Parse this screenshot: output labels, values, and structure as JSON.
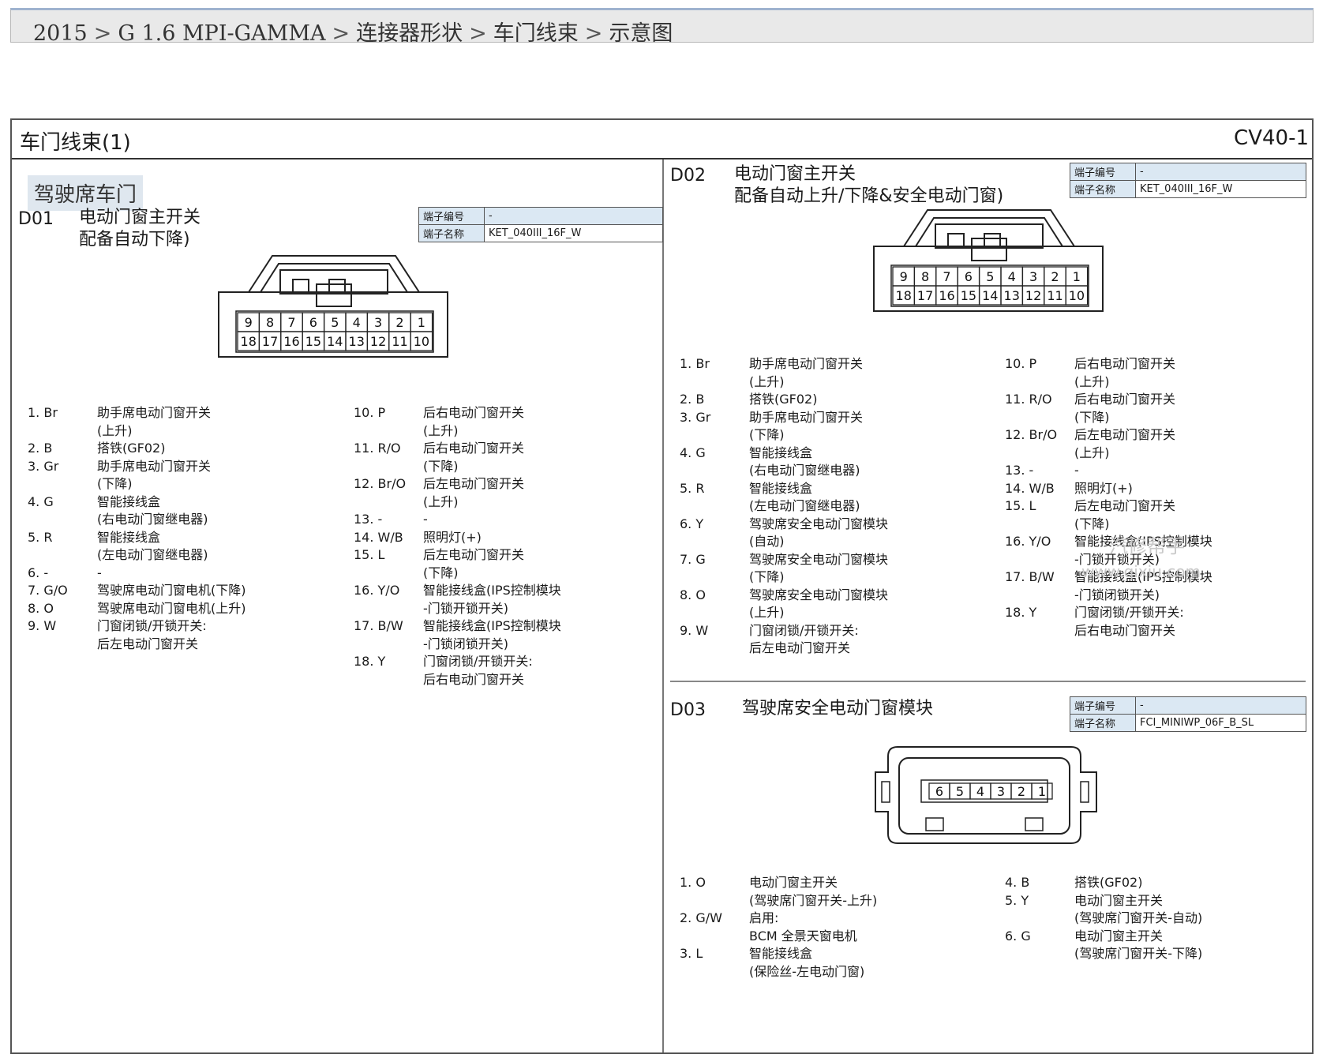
{
  "breadcrumb": {
    "items": [
      "2015",
      "G 1.6 MPI-GAMMA",
      "连接器形状",
      "车门线束",
      "示意图"
    ],
    "separator": ">"
  },
  "sheet": {
    "title": "车门线束(1)",
    "code": "CV40-1",
    "section_label": "驾驶席车门"
  },
  "connectors": {
    "d01": {
      "id": "D01",
      "title_lines": [
        "电动门窗主开关",
        "配备自动下降)"
      ],
      "terminal_no_label": "端子编号",
      "terminal_no_value": "-",
      "terminal_name_label": "端子名称",
      "terminal_name_value": "KET_040III_16F_W",
      "top_pins": [
        "9",
        "8",
        "7",
        "6",
        "5",
        "4",
        "3",
        "2",
        "1"
      ],
      "bottom_pins": [
        "18",
        "17",
        "16",
        "15",
        "14",
        "13",
        "12",
        "11",
        "10"
      ],
      "pins_left": [
        {
          "num": "1. Br",
          "lines": [
            "助手席电动门窗开关",
            "(上升)"
          ]
        },
        {
          "num": "2. B",
          "lines": [
            "搭铁(GF02)"
          ]
        },
        {
          "num": "3. Gr",
          "lines": [
            "助手席电动门窗开关",
            "(下降)"
          ]
        },
        {
          "num": "4. G",
          "lines": [
            "智能接线盒",
            "(右电动门窗继电器)"
          ]
        },
        {
          "num": "5. R",
          "lines": [
            "智能接线盒",
            "(左电动门窗继电器)"
          ]
        },
        {
          "num": "6. -",
          "lines": [
            "-"
          ]
        },
        {
          "num": "7. G/O",
          "lines": [
            "驾驶席电动门窗电机(下降)"
          ]
        },
        {
          "num": "8. O",
          "lines": [
            "驾驶席电动门窗电机(上升)"
          ]
        },
        {
          "num": "9. W",
          "lines": [
            "门窗闭锁/开锁开关:",
            "后左电动门窗开关"
          ]
        }
      ],
      "pins_right": [
        {
          "num": "10. P",
          "lines": [
            "后右电动门窗开关",
            "(上升)"
          ]
        },
        {
          "num": "11. R/O",
          "lines": [
            "后右电动门窗开关",
            "(下降)"
          ]
        },
        {
          "num": "12. Br/O",
          "lines": [
            "后左电动门窗开关",
            "(上升)"
          ]
        },
        {
          "num": "13. -",
          "lines": [
            "-"
          ]
        },
        {
          "num": "14. W/B",
          "lines": [
            "照明灯(+)"
          ]
        },
        {
          "num": "15. L",
          "lines": [
            "后左电动门窗开关",
            "(下降)"
          ]
        },
        {
          "num": "16. Y/O",
          "lines": [
            "智能接线盒(IPS控制模块",
            "-门锁开锁开关)"
          ]
        },
        {
          "num": "17. B/W",
          "lines": [
            "智能接线盒(IPS控制模块",
            "-门锁闭锁开关)"
          ]
        },
        {
          "num": "18. Y",
          "lines": [
            "门窗闭锁/开锁开关:",
            "后右电动门窗开关"
          ]
        }
      ]
    },
    "d02": {
      "id": "D02",
      "title_lines": [
        "电动门窗主开关",
        "配备自动上升/下降&安全电动门窗)"
      ],
      "terminal_no_label": "端子编号",
      "terminal_no_value": "-",
      "terminal_name_label": "端子名称",
      "terminal_name_value": "KET_040III_16F_W",
      "top_pins": [
        "9",
        "8",
        "7",
        "6",
        "5",
        "4",
        "3",
        "2",
        "1"
      ],
      "bottom_pins": [
        "18",
        "17",
        "16",
        "15",
        "14",
        "13",
        "12",
        "11",
        "10"
      ],
      "pins_left": [
        {
          "num": "1. Br",
          "lines": [
            "助手席电动门窗开关",
            "(上升)"
          ]
        },
        {
          "num": "2. B",
          "lines": [
            "搭铁(GF02)"
          ]
        },
        {
          "num": "3. Gr",
          "lines": [
            "助手席电动门窗开关",
            "(下降)"
          ]
        },
        {
          "num": "4. G",
          "lines": [
            "智能接线盒",
            "(右电动门窗继电器)"
          ]
        },
        {
          "num": "5. R",
          "lines": [
            "智能接线盒",
            "(左电动门窗继电器)"
          ]
        },
        {
          "num": "6. Y",
          "lines": [
            "驾驶席安全电动门窗模块",
            "(自动)"
          ]
        },
        {
          "num": "7. G",
          "lines": [
            "驾驶席安全电动门窗模块",
            "(下降)"
          ]
        },
        {
          "num": "8. O",
          "lines": [
            "驾驶席安全电动门窗模块",
            "(上升)"
          ]
        },
        {
          "num": "9. W",
          "lines": [
            "门窗闭锁/开锁开关:",
            "后左电动门窗开关"
          ]
        }
      ],
      "pins_right": [
        {
          "num": "10. P",
          "lines": [
            "后右电动门窗开关",
            "(上升)"
          ]
        },
        {
          "num": "11. R/O",
          "lines": [
            "后右电动门窗开关",
            "(下降)"
          ]
        },
        {
          "num": "12. Br/O",
          "lines": [
            "后左电动门窗开关",
            "(上升)"
          ]
        },
        {
          "num": "13. -",
          "lines": [
            "-"
          ]
        },
        {
          "num": "14. W/B",
          "lines": [
            "照明灯(+)"
          ]
        },
        {
          "num": "15. L",
          "lines": [
            "后左电动门窗开关",
            "(下降)"
          ]
        },
        {
          "num": "16. Y/O",
          "lines": [
            "智能接线盒(IPS控制模块",
            "-门锁开锁开关)"
          ]
        },
        {
          "num": "17. B/W",
          "lines": [
            "智能接线盒(IPS控制模块",
            "-门锁闭锁开关)"
          ]
        },
        {
          "num": "18. Y",
          "lines": [
            "门窗闭锁/开锁开关:",
            "后右电动门窗开关"
          ]
        }
      ]
    },
    "d03": {
      "id": "D03",
      "title_lines": [
        "驾驶席安全电动门窗模块"
      ],
      "terminal_no_label": "端子编号",
      "terminal_no_value": "-",
      "terminal_name_label": "端子名称",
      "terminal_name_value": "FCI_MINIWP_06F_B_SL",
      "pins": [
        "6",
        "5",
        "4",
        "3",
        "2",
        "1"
      ],
      "pins_left": [
        {
          "num": "1. O",
          "lines": [
            "电动门窗主开关",
            "(驾驶席门窗开关-上升)"
          ]
        },
        {
          "num": "2. G/W",
          "lines": [
            "启用:",
            "BCM 全景天窗电机"
          ]
        },
        {
          "num": "3. L",
          "lines": [
            "智能接线盒",
            "(保险丝-左电动门窗)"
          ]
        }
      ],
      "pins_right": [
        {
          "num": "4. B",
          "lines": [
            "搭铁(GF02)"
          ]
        },
        {
          "num": "5. Y",
          "lines": [
            "电动门窗主开关",
            "(驾驶席门窗开关-自动)"
          ]
        },
        {
          "num": "6. G",
          "lines": [
            "电动门窗主开关",
            "(驾驶席门窗开关-下降)"
          ]
        }
      ]
    }
  },
  "watermark": {
    "line1": "汽修帮手",
    "line2": "www.qixiu.com"
  }
}
